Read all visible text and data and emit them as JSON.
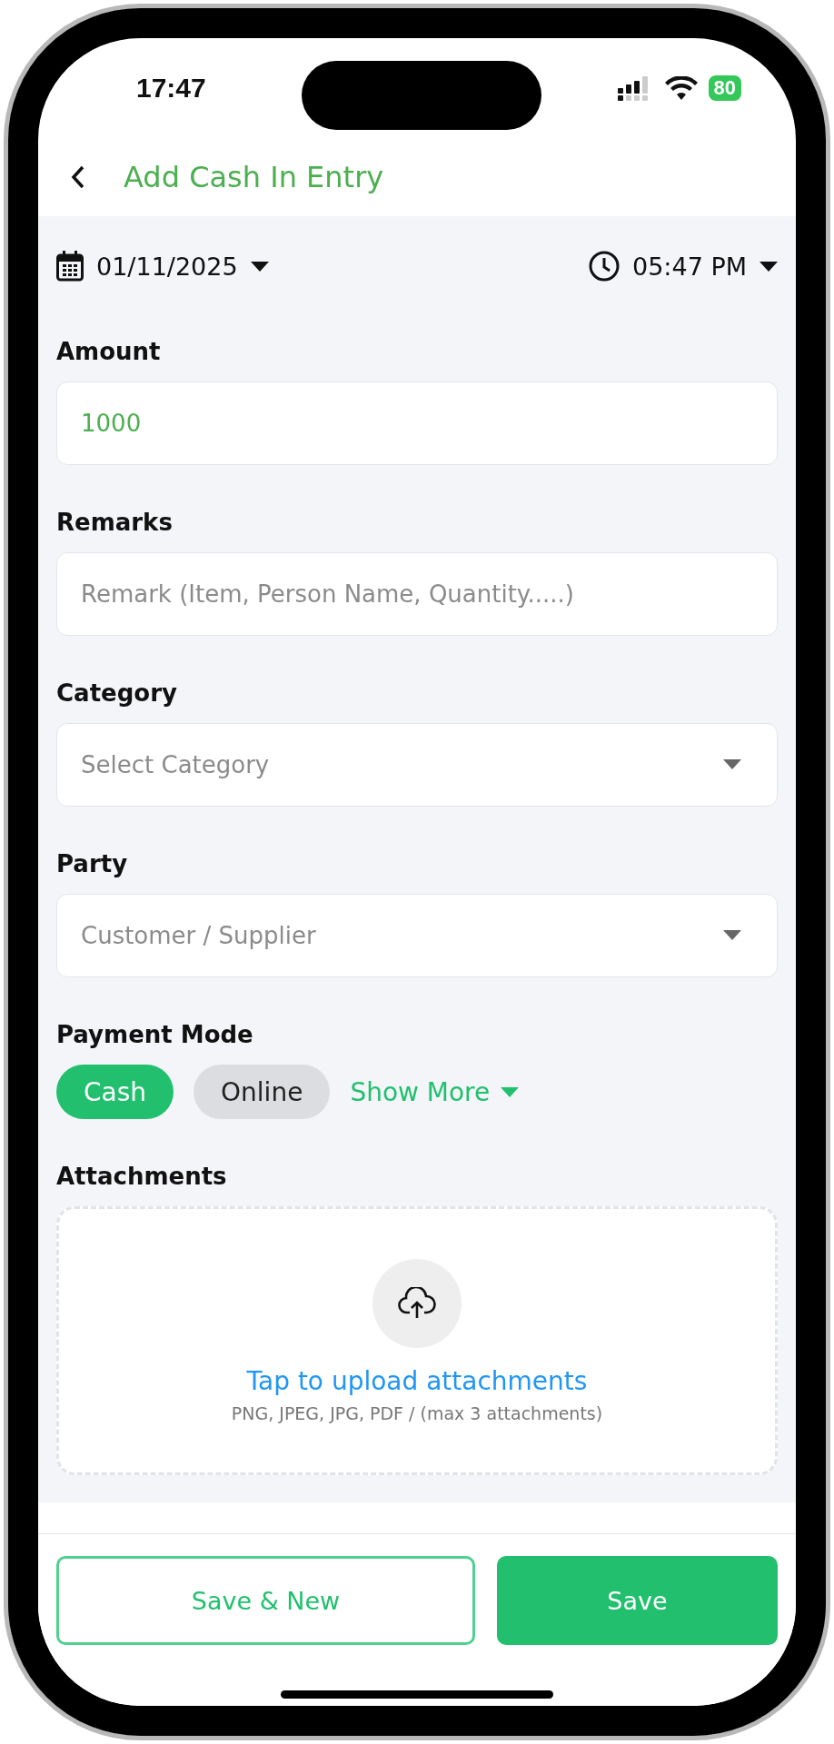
{
  "status_bar": {
    "time": "17:47",
    "battery": "80"
  },
  "header": {
    "title": "Add Cash In Entry"
  },
  "date_time": {
    "date": "01/11/2025",
    "time": "05:47 PM"
  },
  "fields": [
    {
      "kind": "text",
      "label": "Amount",
      "value": "1000"
    },
    {
      "kind": "text",
      "label": "Remarks",
      "placeholder": "Remark (Item, Person Name, Quantity.....)"
    },
    {
      "kind": "select",
      "label": "Category",
      "placeholder": "Select Category"
    },
    {
      "kind": "select",
      "label": "Party",
      "placeholder": "Customer / Supplier"
    }
  ],
  "payment_mode": {
    "label": "Payment Mode",
    "options": [
      {
        "label": "Cash",
        "selected": true
      },
      {
        "label": "Online",
        "selected": false
      }
    ],
    "show_more": "Show More"
  },
  "attachments": {
    "label": "Attachments",
    "action": "Tap to upload attachments",
    "hint": "PNG, JPEG, JPG, PDF / (max 3 attachments)"
  },
  "buttons": [
    {
      "label": "Save & New",
      "kind": "outline"
    },
    {
      "label": "Save",
      "kind": "primary"
    }
  ]
}
